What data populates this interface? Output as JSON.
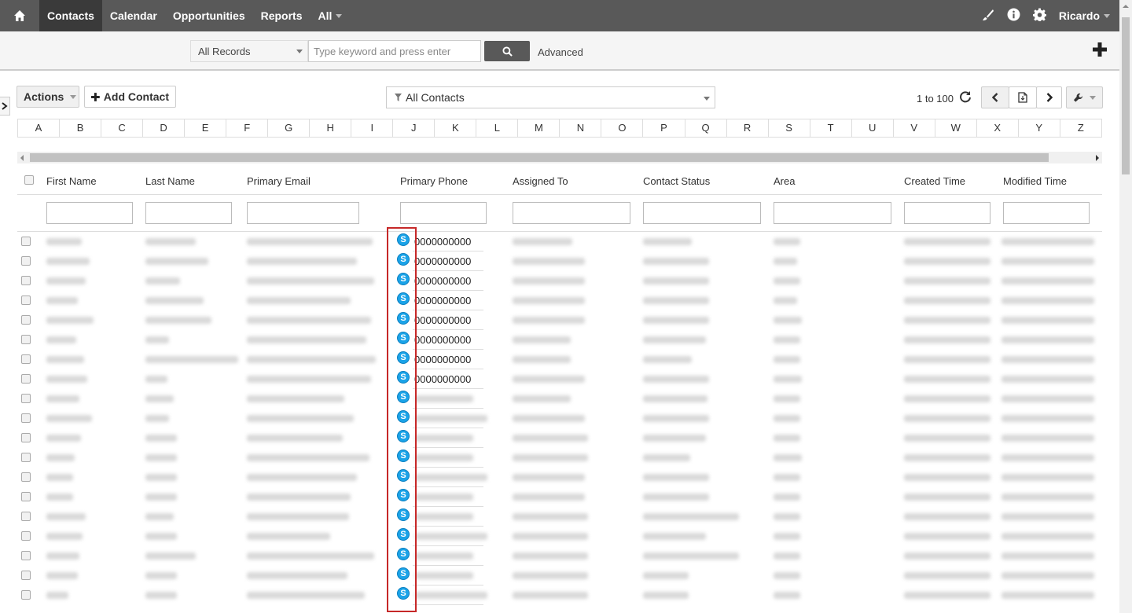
{
  "topbar": {
    "nav": [
      {
        "label": "Contacts",
        "active": true
      },
      {
        "label": "Calendar",
        "active": false
      },
      {
        "label": "Opportunities",
        "active": false
      },
      {
        "label": "Reports",
        "active": false
      },
      {
        "label": "All",
        "active": false
      }
    ],
    "user": "Ricardo"
  },
  "search": {
    "scope": "All Records",
    "placeholder": "Type keyword and press enter",
    "advanced": "Advanced"
  },
  "toolbar": {
    "actions": "Actions",
    "add_contact": "Add Contact",
    "filter": "All Contacts",
    "range": "1 to 100"
  },
  "alphabet": [
    "A",
    "B",
    "C",
    "D",
    "E",
    "F",
    "G",
    "H",
    "I",
    "J",
    "K",
    "L",
    "M",
    "N",
    "O",
    "P",
    "Q",
    "R",
    "S",
    "T",
    "U",
    "V",
    "W",
    "X",
    "Y",
    "Z"
  ],
  "columns": [
    "First Name",
    "Last Name",
    "Primary Email",
    "Primary Phone",
    "Assigned To",
    "Contact Status",
    "Area",
    "Created Time",
    "Modified Time"
  ],
  "rows": [
    {
      "phone": "0000000000"
    },
    {
      "phone": "0000000000"
    },
    {
      "phone": "0000000000"
    },
    {
      "phone": "0000000000"
    },
    {
      "phone": "0000000000"
    },
    {
      "phone": "0000000000"
    },
    {
      "phone": "0000000000"
    },
    {
      "phone": "0000000000"
    }
  ],
  "colors": {
    "topbar": "#595959",
    "highlight": "#c62828",
    "skype": "#1aa3e8"
  }
}
